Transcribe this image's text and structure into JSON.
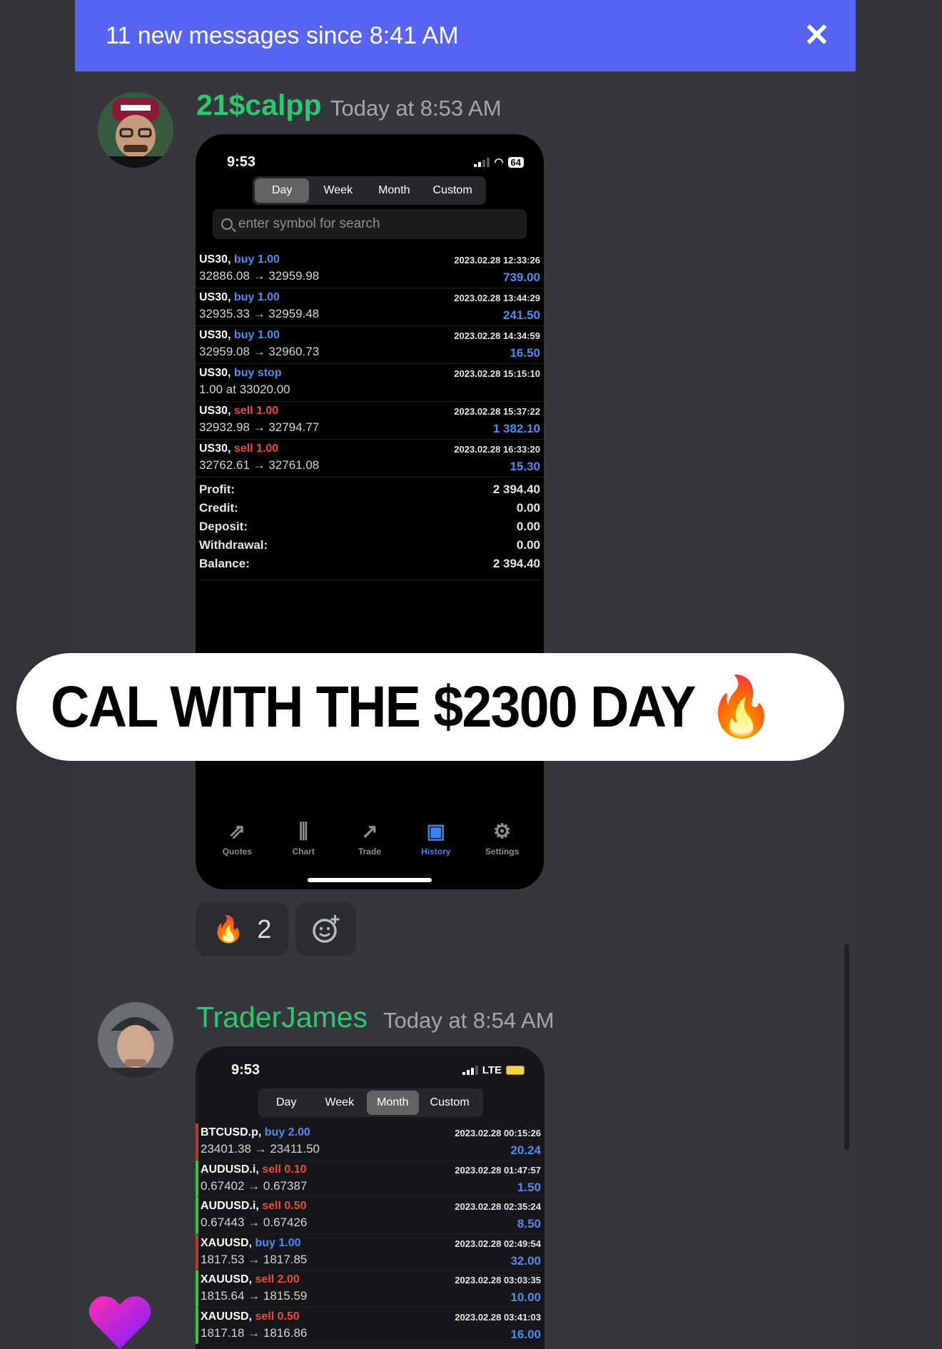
{
  "new_messages_bar": {
    "text": "11 new messages since 8:41 AM",
    "close_glyph": "✕",
    "color": "#5865f2"
  },
  "messages": [
    {
      "author": "21$calpp",
      "author_color": "#2dc770",
      "timestamp": "Today at 8:53 AM",
      "screenshot": {
        "time": "9:53",
        "battery": "64",
        "tabs": [
          "Day",
          "Week",
          "Month",
          "Custom"
        ],
        "active_tab": "Day",
        "search_placeholder": "enter symbol for search",
        "trades": [
          {
            "symbol": "US30,",
            "action": "buy 1.00",
            "side": "buy",
            "prices": "32886.08 → 32959.98",
            "time": "2023.02.28 12:33:26",
            "profit": "739.00"
          },
          {
            "symbol": "US30,",
            "action": "buy 1.00",
            "side": "buy",
            "prices": "32935.33 → 32959.48",
            "time": "2023.02.28 13:44:29",
            "profit": "241.50"
          },
          {
            "symbol": "US30,",
            "action": "buy 1.00",
            "side": "buy",
            "prices": "32959.08 → 32960.73",
            "time": "2023.02.28 14:34:59",
            "profit": "16.50"
          },
          {
            "symbol": "US30,",
            "action": "buy stop",
            "side": "buy",
            "prices": "1.00 at 33020.00",
            "time": "2023.02.28 15:15:10",
            "profit": ""
          },
          {
            "symbol": "US30,",
            "action": "sell 1.00",
            "side": "sell",
            "prices": "32932.98 → 32794.77",
            "time": "2023.02.28 15:37:22",
            "profit": "1 382.10"
          },
          {
            "symbol": "US30,",
            "action": "sell 1.00",
            "side": "sell",
            "prices": "32762.61 → 32761.08",
            "time": "2023.02.28 16:33:20",
            "profit": "15.30"
          }
        ],
        "summary": [
          {
            "label": "Profit:",
            "value": "2 394.40"
          },
          {
            "label": "Credit:",
            "value": "0.00"
          },
          {
            "label": "Deposit:",
            "value": "0.00"
          },
          {
            "label": "Withdrawal:",
            "value": "0.00"
          },
          {
            "label": "Balance:",
            "value": "2 394.40"
          }
        ],
        "tabbar": [
          {
            "label": "Quotes",
            "icon": "quotes-icon",
            "glyph": "⇗",
            "active": false
          },
          {
            "label": "Chart",
            "icon": "chart-icon",
            "glyph": "⫼",
            "active": false
          },
          {
            "label": "Trade",
            "icon": "trade-icon",
            "glyph": "↗",
            "active": false
          },
          {
            "label": "History",
            "icon": "history-icon",
            "glyph": "▣",
            "active": true
          },
          {
            "label": "Settings",
            "icon": "settings-icon",
            "glyph": "⚙",
            "active": false
          }
        ]
      },
      "caption": "CAL WITH THE $2300 DAY 🔥",
      "reactions": [
        {
          "emoji": "🔥",
          "count": "2"
        }
      ]
    },
    {
      "author": "TraderJames",
      "author_color": "#2dc770",
      "timestamp": "Today at 8:54 AM",
      "screenshot": {
        "time": "9:53",
        "network": "LTE",
        "tabs": [
          "Day",
          "Week",
          "Month",
          "Custom"
        ],
        "active_tab": "Month",
        "trades": [
          {
            "symbol": "BTCUSD.p,",
            "action": "buy 2.00",
            "side": "buy",
            "prices": "23401.38 → 23411.50",
            "time": "2023.02.28 00:15:26",
            "profit": "20.24",
            "bar": "red"
          },
          {
            "symbol": "AUDUSD.i,",
            "action": "sell 0.10",
            "side": "sell",
            "prices": "0.67402 → 0.67387",
            "time": "2023.02.28 01:47:57",
            "profit": "1.50",
            "bar": "green"
          },
          {
            "symbol": "AUDUSD.i,",
            "action": "sell 0.50",
            "side": "sell",
            "prices": "0.67443 → 0.67426",
            "time": "2023.02.28 02:35:24",
            "profit": "8.50",
            "bar": "green"
          },
          {
            "symbol": "XAUUSD,",
            "action": "buy 1.00",
            "side": "buy",
            "prices": "1817.53 → 1817.85",
            "time": "2023.02.28 02:49:54",
            "profit": "32.00",
            "bar": "red"
          },
          {
            "symbol": "XAUUSD,",
            "action": "sell 2.00",
            "side": "sell",
            "prices": "1815.64 → 1815.59",
            "time": "2023.02.28 03:03:35",
            "profit": "10.00",
            "bar": "green"
          },
          {
            "symbol": "XAUUSD,",
            "action": "sell 0.50",
            "side": "sell",
            "prices": "1817.18 → 1816.86",
            "time": "2023.02.28 03:41:03",
            "profit": "16.00",
            "bar": "green"
          }
        ]
      }
    }
  ]
}
